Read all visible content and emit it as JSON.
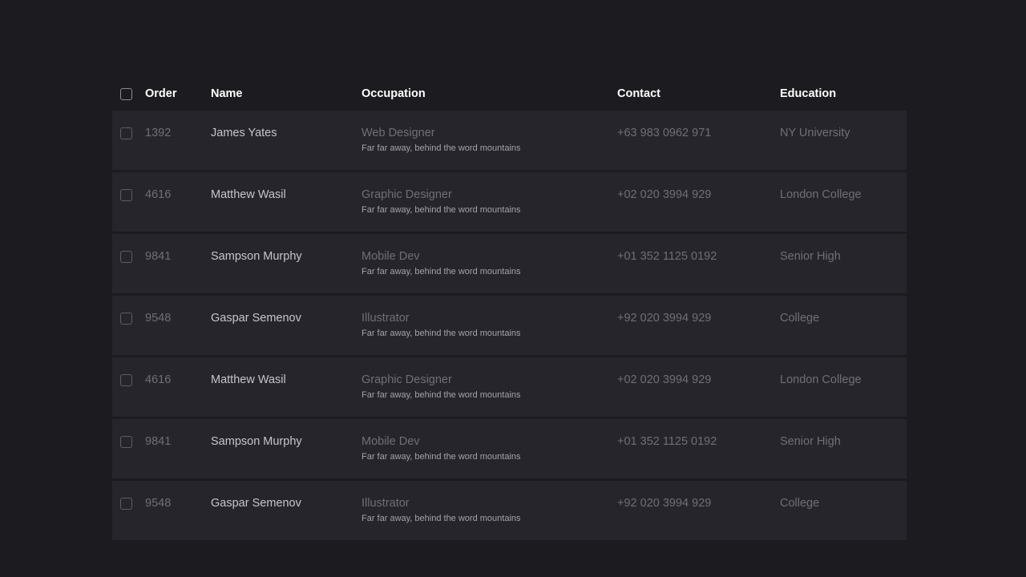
{
  "header": {
    "order": "Order",
    "name": "Name",
    "occupation": "Occupation",
    "contact": "Contact",
    "education": "Education"
  },
  "rows": [
    {
      "order": "1392",
      "name": "James Yates",
      "occupation": "Web Designer",
      "description": "Far far away, behind the word mountains",
      "contact": "+63 983 0962 971",
      "education": "NY University"
    },
    {
      "order": "4616",
      "name": "Matthew Wasil",
      "occupation": "Graphic Designer",
      "description": "Far far away, behind the word mountains",
      "contact": "+02 020 3994 929",
      "education": "London College"
    },
    {
      "order": "9841",
      "name": "Sampson Murphy",
      "occupation": "Mobile Dev",
      "description": "Far far away, behind the word mountains",
      "contact": "+01 352 1125 0192",
      "education": "Senior High"
    },
    {
      "order": "9548",
      "name": "Gaspar Semenov",
      "occupation": "Illustrator",
      "description": "Far far away, behind the word mountains",
      "contact": "+92 020 3994 929",
      "education": "College"
    },
    {
      "order": "4616",
      "name": "Matthew Wasil",
      "occupation": "Graphic Designer",
      "description": "Far far away, behind the word mountains",
      "contact": "+02 020 3994 929",
      "education": "London College"
    },
    {
      "order": "9841",
      "name": "Sampson Murphy",
      "occupation": "Mobile Dev",
      "description": "Far far away, behind the word mountains",
      "contact": "+01 352 1125 0192",
      "education": "Senior High"
    },
    {
      "order": "9548",
      "name": "Gaspar Semenov",
      "occupation": "Illustrator",
      "description": "Far far away, behind the word mountains",
      "contact": "+92 020 3994 929",
      "education": "College"
    }
  ]
}
